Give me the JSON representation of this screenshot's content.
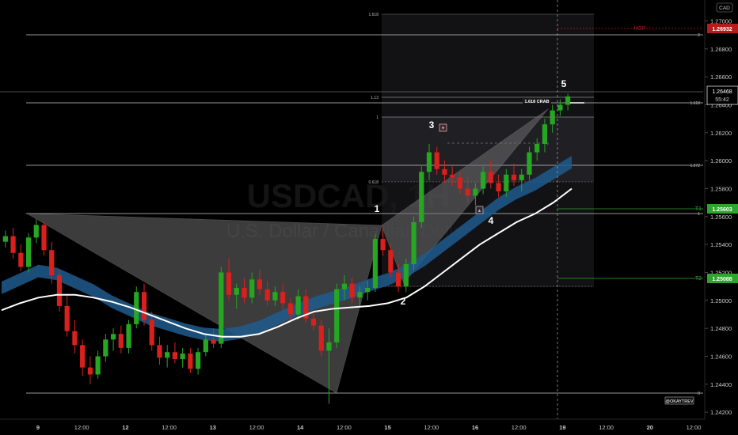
{
  "header": {
    "currency": "CAD"
  },
  "watermark": {
    "symbol": "USDCAD, 1H",
    "description": "U.S. Dollar / Canadian Dollar"
  },
  "price_axis": {
    "ticks": [
      "1.27000",
      "1.26800",
      "1.26600",
      "1.26400",
      "1.26200",
      "1.26000",
      "1.25800",
      "1.25600",
      "1.25400",
      "1.25200",
      "1.25000",
      "1.24800",
      "1.24600",
      "1.24400",
      "1.24200"
    ],
    "current_price": "1.26468",
    "countdown": "55:42",
    "hop_price": "1.26932",
    "t1_price": "1.25603",
    "t2_price": "1.25088"
  },
  "time_axis": [
    "9",
    "12:00",
    "12",
    "12:00",
    "13",
    "12:00",
    "14",
    "12:00",
    "15",
    "12:00",
    "16",
    "12:00",
    "19",
    "12:00",
    "20",
    "12:00"
  ],
  "labels": {
    "hop": "HOP",
    "t1": "T1",
    "t2": "T2",
    "crab": "1.618 CRAB",
    "fib_1618_right": "1.618",
    "fib_1272_right": "1.272",
    "fib_2": "2",
    "fib_1": "1",
    "fib_0": "0",
    "box_1618": "1.618",
    "box_113": "1.13",
    "box_1": "1",
    "box_0618": "0.618",
    "author": "@OKAYTREV"
  },
  "wave_labels": [
    "1",
    "2",
    "3",
    "4",
    "5"
  ],
  "colors": {
    "bullish": "#26a621",
    "bearish": "#d8201c",
    "ema": "#ffffff",
    "ema_band": "#1e5a8c",
    "hop": "#b71c1c",
    "target": "#2fa52f",
    "background": "#000000"
  },
  "chart_data": {
    "type": "candlestick",
    "symbol": "USDCAD",
    "timeframe": "1H",
    "ylim": [
      1.2415,
      1.2715
    ],
    "levels": {
      "hop": 1.26932,
      "t1": 1.25603,
      "t2": 1.25088,
      "current": 1.26468
    },
    "fib_levels": {
      "2": 1.269,
      "1.618": 1.26365,
      "1.272": 1.2593,
      "1": 1.2557,
      "0": 1.2425
    },
    "pattern": "Bearish Crab",
    "pattern_points": {
      "X": {
        "bar": 0,
        "price": 1.2558
      },
      "A": {
        "bar": 70,
        "price": 1.2425
      },
      "B": {
        "bar": 79,
        "price": 1.255
      },
      "C": {
        "bar": 84,
        "price": 1.2506
      },
      "D": {
        "bar": 110,
        "price": 1.2638
      }
    },
    "ema_band": [
      1.2508,
      1.2514,
      1.252,
      1.2518,
      1.2512,
      1.2506,
      1.2498,
      1.2492,
      1.2486,
      1.2482,
      1.2478,
      1.2475,
      1.2474,
      1.2476,
      1.248,
      1.2486,
      1.2492,
      1.2497,
      1.2501,
      1.2505,
      1.251,
      1.2514,
      1.252,
      1.2528,
      1.2538,
      1.2548,
      1.2558,
      1.2568,
      1.2576,
      1.2582,
      1.259,
      1.2598
    ],
    "ema_white": [
      1.2493,
      1.2498,
      1.2502,
      1.2504,
      1.2504,
      1.2502,
      1.2499,
      1.2495,
      1.249,
      1.2485,
      1.248,
      1.2476,
      1.2474,
      1.2474,
      1.2476,
      1.2481,
      1.2487,
      1.2492,
      1.2494,
      1.2495,
      1.2496,
      1.2498,
      1.2502,
      1.251,
      1.252,
      1.253,
      1.254,
      1.2548,
      1.2556,
      1.2562,
      1.257,
      1.258
    ],
    "candles": [
      [
        1.2542,
        1.255,
        1.2538,
        1.2546
      ],
      [
        1.2546,
        1.2552,
        1.253,
        1.2534
      ],
      [
        1.2534,
        1.254,
        1.2521,
        1.2524
      ],
      [
        1.2524,
        1.2548,
        1.252,
        1.2545
      ],
      [
        1.2545,
        1.2558,
        1.2541,
        1.2554
      ],
      [
        1.2554,
        1.2556,
        1.2532,
        1.2536
      ],
      [
        1.2536,
        1.2542,
        1.2512,
        1.2518
      ],
      [
        1.2518,
        1.2522,
        1.2492,
        1.2496
      ],
      [
        1.2496,
        1.2504,
        1.2474,
        1.2478
      ],
      [
        1.2478,
        1.2486,
        1.2462,
        1.2468
      ],
      [
        1.2468,
        1.2472,
        1.2446,
        1.2452
      ],
      [
        1.2452,
        1.246,
        1.244,
        1.2447
      ],
      [
        1.2447,
        1.2464,
        1.2444,
        1.246
      ],
      [
        1.246,
        1.2476,
        1.2456,
        1.2472
      ],
      [
        1.2472,
        1.248,
        1.2464,
        1.2476
      ],
      [
        1.2476,
        1.2482,
        1.2462,
        1.2466
      ],
      [
        1.2466,
        1.2486,
        1.2462,
        1.2483
      ],
      [
        1.2483,
        1.251,
        1.248,
        1.2506
      ],
      [
        1.2506,
        1.2512,
        1.2482,
        1.2486
      ],
      [
        1.2486,
        1.2492,
        1.2464,
        1.2468
      ],
      [
        1.2468,
        1.2474,
        1.2454,
        1.2459
      ],
      [
        1.2459,
        1.2468,
        1.2452,
        1.2463
      ],
      [
        1.2463,
        1.247,
        1.2455,
        1.2458
      ],
      [
        1.2458,
        1.2466,
        1.2452,
        1.2462
      ],
      [
        1.2462,
        1.2466,
        1.2448,
        1.2451
      ],
      [
        1.2451,
        1.2466,
        1.2447,
        1.2463
      ],
      [
        1.2463,
        1.2476,
        1.246,
        1.2472
      ],
      [
        1.2472,
        1.248,
        1.2466,
        1.2469
      ],
      [
        1.2469,
        1.2524,
        1.2466,
        1.252
      ],
      [
        1.252,
        1.253,
        1.25,
        1.2504
      ],
      [
        1.2504,
        1.2512,
        1.2494,
        1.2509
      ],
      [
        1.2509,
        1.2516,
        1.2498,
        1.2502
      ],
      [
        1.2502,
        1.252,
        1.2498,
        1.2515
      ],
      [
        1.2515,
        1.2522,
        1.2504,
        1.2508
      ],
      [
        1.2508,
        1.2514,
        1.2496,
        1.25
      ],
      [
        1.25,
        1.251,
        1.2496,
        1.2506
      ],
      [
        1.2506,
        1.2512,
        1.2494,
        1.2498
      ],
      [
        1.2498,
        1.2502,
        1.2486,
        1.249
      ],
      [
        1.249,
        1.2508,
        1.2486,
        1.2503
      ],
      [
        1.2503,
        1.2508,
        1.2484,
        1.2487
      ],
      [
        1.2487,
        1.2492,
        1.2478,
        1.2482
      ],
      [
        1.2482,
        1.2486,
        1.246,
        1.2464
      ],
      [
        1.2464,
        1.248,
        1.2426,
        1.247
      ],
      [
        1.247,
        1.2512,
        1.2466,
        1.2508
      ],
      [
        1.2508,
        1.2518,
        1.25,
        1.2512
      ],
      [
        1.2512,
        1.2516,
        1.2498,
        1.2502
      ],
      [
        1.2502,
        1.251,
        1.2496,
        1.2506
      ],
      [
        1.2506,
        1.2514,
        1.25,
        1.2509
      ],
      [
        1.2509,
        1.2548,
        1.2506,
        1.2544
      ],
      [
        1.2544,
        1.2552,
        1.2532,
        1.2536
      ],
      [
        1.2536,
        1.254,
        1.2516,
        1.252
      ],
      [
        1.252,
        1.2526,
        1.2506,
        1.251
      ],
      [
        1.251,
        1.253,
        1.2506,
        1.2526
      ],
      [
        1.2526,
        1.256,
        1.2522,
        1.2556
      ],
      [
        1.2556,
        1.2596,
        1.2552,
        1.2592
      ],
      [
        1.2592,
        1.2612,
        1.2586,
        1.2606
      ],
      [
        1.2606,
        1.261,
        1.259,
        1.2594
      ],
      [
        1.2594,
        1.26,
        1.2584,
        1.259
      ],
      [
        1.259,
        1.2596,
        1.2582,
        1.2588
      ],
      [
        1.2588,
        1.2592,
        1.2576,
        1.258
      ],
      [
        1.258,
        1.2588,
        1.257,
        1.2575
      ],
      [
        1.2575,
        1.2584,
        1.2568,
        1.258
      ],
      [
        1.258,
        1.2596,
        1.2576,
        1.2592
      ],
      [
        1.2592,
        1.26,
        1.258,
        1.2584
      ],
      [
        1.2584,
        1.259,
        1.2574,
        1.2578
      ],
      [
        1.2578,
        1.2594,
        1.2574,
        1.259
      ],
      [
        1.259,
        1.2598,
        1.2582,
        1.2586
      ],
      [
        1.2586,
        1.2594,
        1.2578,
        1.259
      ],
      [
        1.259,
        1.261,
        1.2586,
        1.2606
      ],
      [
        1.2606,
        1.2616,
        1.26,
        1.2612
      ],
      [
        1.2612,
        1.263,
        1.2606,
        1.2626
      ],
      [
        1.2626,
        1.264,
        1.262,
        1.2636
      ],
      [
        1.2636,
        1.2644,
        1.2632,
        1.264
      ],
      [
        1.264,
        1.2648,
        1.2636,
        1.2646
      ]
    ]
  }
}
